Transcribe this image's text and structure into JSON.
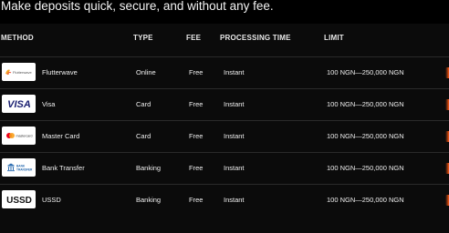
{
  "intro": "Make deposits quick, secure, and without any fee.",
  "columns": {
    "method": "METHOD",
    "type": "TYPE",
    "fee": "FEE",
    "processing": "PROCESSING TIME",
    "limit": "LIMIT"
  },
  "rows": [
    {
      "name": "Flutterwave",
      "type": "Online",
      "fee": "Free",
      "processing": "Instant",
      "limit": "100 NGN—250,000 NGN",
      "logo_icon": "flutterwave-logo",
      "logo_text": "Flutterwave"
    },
    {
      "name": "Visa",
      "type": "Card",
      "fee": "Free",
      "processing": "Instant",
      "limit": "100 NGN—250,000 NGN",
      "logo_icon": "visa-logo",
      "logo_text": "VISA"
    },
    {
      "name": "Master Card",
      "type": "Card",
      "fee": "Free",
      "processing": "Instant",
      "limit": "100 NGN—250,000 NGN",
      "logo_icon": "mastercard-logo",
      "logo_text": "mastercard"
    },
    {
      "name": "Bank Transfer",
      "type": "Banking",
      "fee": "Free",
      "processing": "Instant",
      "limit": "100 NGN—250,000 NGN",
      "logo_icon": "bank-transfer-logo",
      "logo_text": "BANK TRANSFER"
    },
    {
      "name": "USSD",
      "type": "Banking",
      "fee": "Free",
      "processing": "Instant",
      "limit": "100 NGN—250,000 NGN",
      "logo_icon": "ussd-logo",
      "logo_text": "USSD"
    }
  ],
  "colors": {
    "background": "#000000",
    "accent_glow": "#ff5a14",
    "visa_blue": "#1a1f71",
    "mastercard_red": "#eb001b",
    "mastercard_yellow": "#f79e1b",
    "flutterwave_orange": "#f5a623"
  }
}
